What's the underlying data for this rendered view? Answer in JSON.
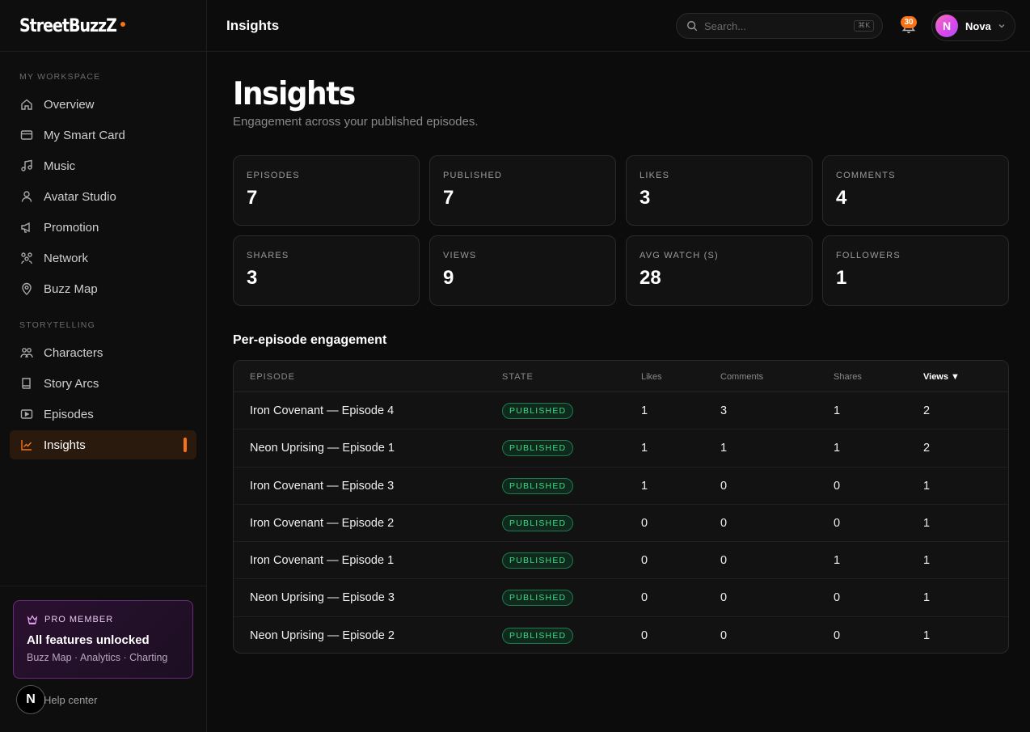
{
  "brand": {
    "name": "StreetBuzzZ"
  },
  "sidebar": {
    "sections": [
      {
        "label": "MY WORKSPACE"
      },
      {
        "label": "STORYTELLING"
      }
    ],
    "items": [
      {
        "label": "Overview",
        "icon": "home-icon"
      },
      {
        "label": "My Smart Card",
        "icon": "card-icon"
      },
      {
        "label": "Music",
        "icon": "music-note-icon"
      },
      {
        "label": "Avatar Studio",
        "icon": "user-icon"
      },
      {
        "label": "Promotion",
        "icon": "megaphone-icon"
      },
      {
        "label": "Network",
        "icon": "network-icon"
      },
      {
        "label": "Buzz Map",
        "icon": "map-pin-icon"
      },
      {
        "label": "Characters",
        "icon": "characters-icon"
      },
      {
        "label": "Story Arcs",
        "icon": "book-icon"
      },
      {
        "label": "Episodes",
        "icon": "video-icon"
      },
      {
        "label": "Insights",
        "icon": "chart-icon",
        "active": true
      }
    ],
    "pro": {
      "label": "PRO MEMBER",
      "title": "All features unlocked",
      "subtitle": "Buzz Map · Analytics · Charting"
    },
    "help": {
      "avatar": "N",
      "label": "Help center"
    }
  },
  "header": {
    "title": "Insights",
    "search": {
      "placeholder": "Search...",
      "shortcut": "⌘K"
    },
    "notifications": {
      "count": "30"
    },
    "user": {
      "initial": "N",
      "name": "Nova"
    }
  },
  "page": {
    "title": "Insights",
    "subtitle": "Engagement across your published episodes."
  },
  "stats": [
    {
      "label": "EPISODES",
      "value": "7"
    },
    {
      "label": "PUBLISHED",
      "value": "7"
    },
    {
      "label": "LIKES",
      "value": "3"
    },
    {
      "label": "COMMENTS",
      "value": "4"
    },
    {
      "label": "SHARES",
      "value": "3"
    },
    {
      "label": "VIEWS",
      "value": "9"
    },
    {
      "label": "AVG WATCH (S)",
      "value": "28"
    },
    {
      "label": "FOLLOWERS",
      "value": "1"
    }
  ],
  "table": {
    "title": "Per-episode engagement",
    "columns": [
      "EPISODE",
      "STATE",
      "Likes",
      "Comments",
      "Shares",
      "Views ▼"
    ],
    "rows": [
      {
        "episode": "Iron Covenant — Episode 4",
        "state": "PUBLISHED",
        "likes": "1",
        "comments": "3",
        "shares": "1",
        "views": "2"
      },
      {
        "episode": "Neon Uprising — Episode 1",
        "state": "PUBLISHED",
        "likes": "1",
        "comments": "1",
        "shares": "1",
        "views": "2"
      },
      {
        "episode": "Iron Covenant — Episode 3",
        "state": "PUBLISHED",
        "likes": "1",
        "comments": "0",
        "shares": "0",
        "views": "1"
      },
      {
        "episode": "Iron Covenant — Episode 2",
        "state": "PUBLISHED",
        "likes": "0",
        "comments": "0",
        "shares": "0",
        "views": "1"
      },
      {
        "episode": "Iron Covenant — Episode 1",
        "state": "PUBLISHED",
        "likes": "0",
        "comments": "0",
        "shares": "1",
        "views": "1"
      },
      {
        "episode": "Neon Uprising — Episode 3",
        "state": "PUBLISHED",
        "likes": "0",
        "comments": "0",
        "shares": "0",
        "views": "1"
      },
      {
        "episode": "Neon Uprising — Episode 2",
        "state": "PUBLISHED",
        "likes": "0",
        "comments": "0",
        "shares": "0",
        "views": "1"
      }
    ]
  },
  "colors": {
    "accent": "#f97316",
    "success": "#3ddc84",
    "pro": "#6b2a7a"
  }
}
